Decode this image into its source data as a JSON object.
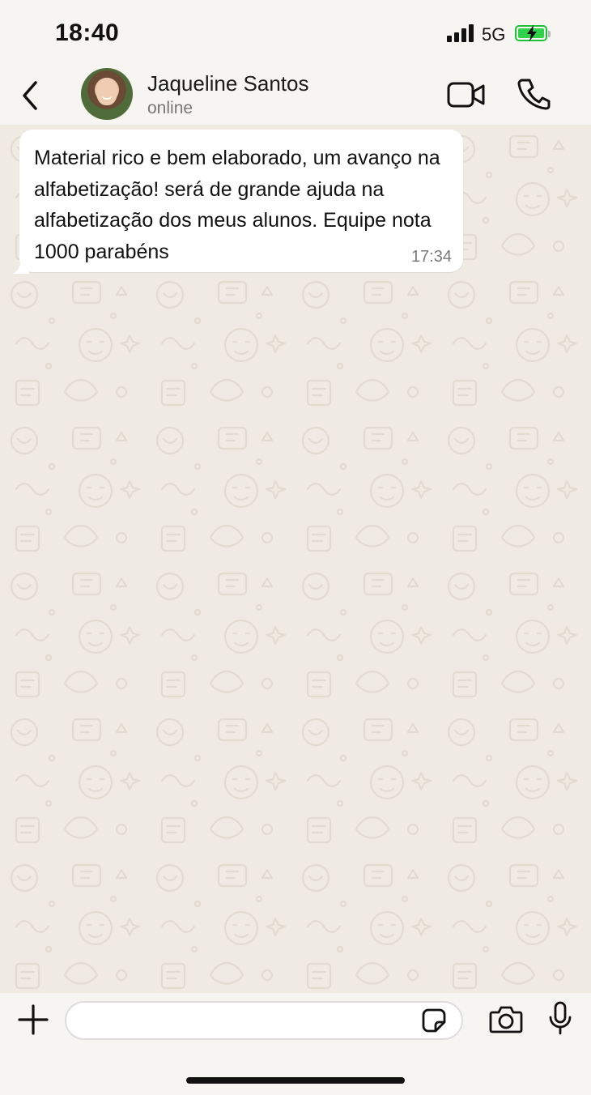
{
  "status_bar": {
    "time": "18:40",
    "network": "5G",
    "icons": [
      "signal-icon",
      "battery-charging-icon"
    ]
  },
  "header": {
    "contact_name": "Jaqueline Santos",
    "contact_status": "online",
    "icons": [
      "back-chevron-icon",
      "avatar",
      "video-call-icon",
      "phone-icon"
    ]
  },
  "messages": [
    {
      "direction": "incoming",
      "text": "Material rico e bem elaborado, um avanço na alfabetização! será de grande ajuda na alfabetização dos meus alunos. Equipe nota 1000 parabéns",
      "time": "17:34"
    }
  ],
  "input_bar": {
    "value": "",
    "placeholder": "",
    "icons": [
      "plus-icon",
      "sticker-icon",
      "camera-icon",
      "mic-icon"
    ]
  },
  "colors": {
    "background": "#f6f5f2",
    "chat_wallpaper": "#efeae2",
    "bubble": "#ffffff",
    "battery": "#2ed34a",
    "timestamp": "#7a7a7a",
    "status_text": "#777777"
  }
}
